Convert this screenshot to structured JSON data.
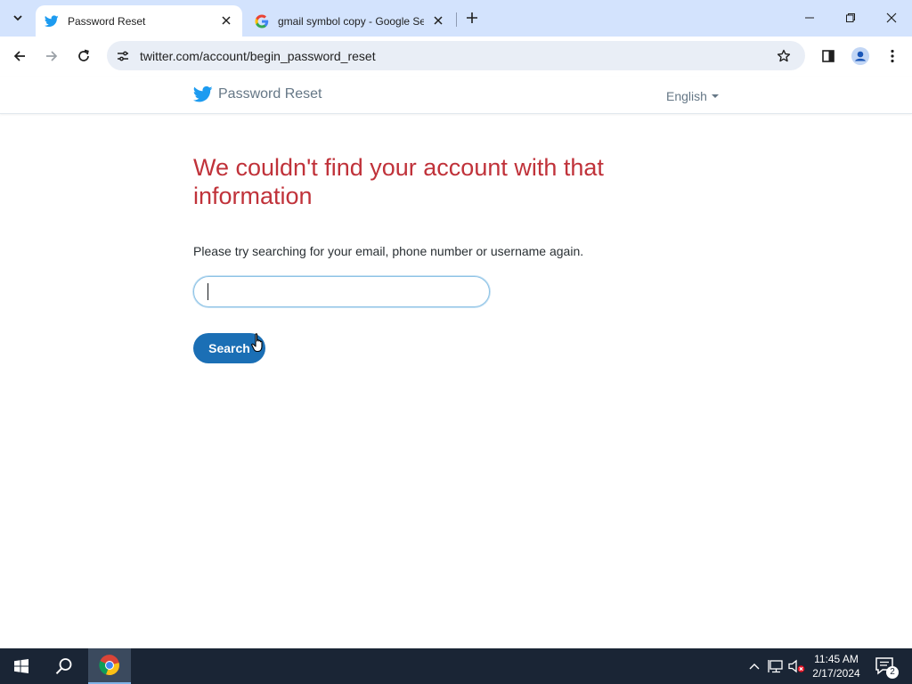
{
  "browser": {
    "tabs": [
      {
        "title": "Password Reset",
        "favicon": "twitter-bird-icon",
        "active": true
      },
      {
        "title": "gmail symbol copy - Google Se",
        "favicon": "google-g-icon",
        "active": false
      }
    ],
    "address_bar": {
      "url": "twitter.com/account/begin_password_reset"
    }
  },
  "page": {
    "brand_text": "Password Reset",
    "language": "English",
    "error_heading": "We couldn't find your account with that information",
    "instructions": "Please try searching for your email, phone number or username again.",
    "search_input": {
      "value": "",
      "placeholder": ""
    },
    "search_button_label": "Search"
  },
  "taskbar": {
    "time": "11:45 AM",
    "date": "2/17/2024",
    "notification_count": "2"
  },
  "colors": {
    "error_red": "#c0323a",
    "twitter_blue": "#1d9bf0",
    "button_blue": "#1b6fb5",
    "tabstrip_bg": "#d3e3fd",
    "taskbar_bg": "#1a2535"
  }
}
